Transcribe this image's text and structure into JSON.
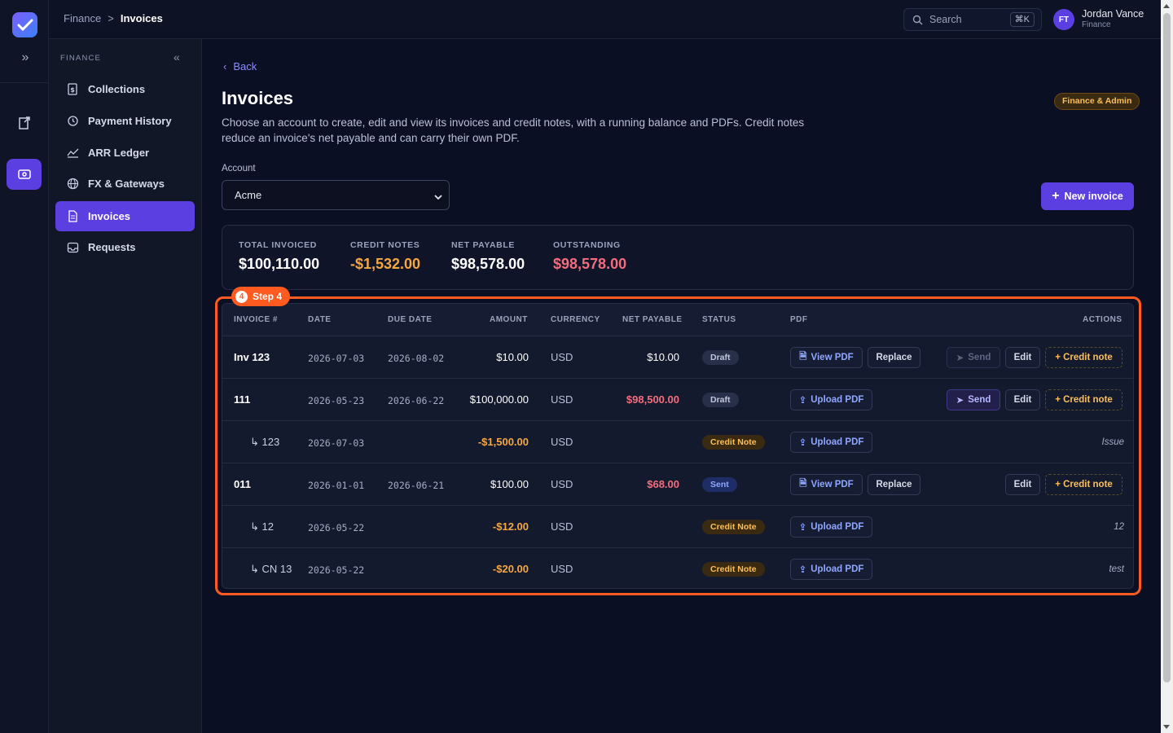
{
  "breadcrumb": {
    "parent": "Finance",
    "separator": ">",
    "current": "Invoices"
  },
  "search": {
    "placeholder": "Search",
    "shortcut": "⌘K"
  },
  "user": {
    "initials": "FT",
    "name": "Jordan Vance",
    "role": "Finance"
  },
  "sidebar": {
    "section": "FINANCE",
    "items": [
      {
        "label": "Collections",
        "icon": "dollar-doc-icon"
      },
      {
        "label": "Payment History",
        "icon": "history-icon"
      },
      {
        "label": "ARR Ledger",
        "icon": "trend-icon"
      },
      {
        "label": "FX & Gateways",
        "icon": "globe-icon"
      },
      {
        "label": "Invoices",
        "icon": "document-icon",
        "active": true
      },
      {
        "label": "Requests",
        "icon": "inbox-icon"
      }
    ]
  },
  "page": {
    "back": "Back",
    "title": "Invoices",
    "description": "Choose an account to create, edit and view its invoices and credit notes, with a running balance and PDFs. Credit notes reduce an invoice's net payable and can carry their own PDF.",
    "badge": "Finance & Admin",
    "account_label": "Account",
    "account_value": "Acme",
    "new_button": "New invoice"
  },
  "summary": {
    "total_label": "TOTAL INVOICED",
    "total": "$100,110.00",
    "credit_label": "CREDIT NOTES",
    "credit": "-$1,532.00",
    "net_label": "NET PAYABLE",
    "net": "$98,578.00",
    "outstanding_label": "OUTSTANDING",
    "outstanding": "$98,578.00"
  },
  "step": {
    "number": "4",
    "label": "Step 4"
  },
  "table": {
    "headers": {
      "invoice": "INVOICE #",
      "date": "DATE",
      "due": "DUE DATE",
      "amount": "AMOUNT",
      "currency": "CURRENCY",
      "net": "NET PAYABLE",
      "status": "STATUS",
      "pdf": "PDF",
      "actions": "ACTIONS"
    },
    "buttons": {
      "view_pdf": "View PDF",
      "upload_pdf": "Upload PDF",
      "replace": "Replace",
      "send": "Send",
      "edit": "Edit",
      "credit": "+ Credit note"
    },
    "rows": [
      {
        "invoice": "Inv 123",
        "date": "2026-07-03",
        "due": "2026-08-02",
        "amount": "$10.00",
        "currency": "USD",
        "net": "$10.00",
        "status": "Draft"
      },
      {
        "invoice": "111",
        "date": "2026-05-23",
        "due": "2026-06-22",
        "amount": "$100,000.00",
        "currency": "USD",
        "net": "$98,500.00",
        "status": "Draft"
      },
      {
        "invoice": "↳ 123",
        "date": "2026-07-03",
        "due": "",
        "amount": "-$1,500.00",
        "currency": "USD",
        "net": "",
        "status": "Credit Note",
        "note": "Issue"
      },
      {
        "invoice": "011",
        "date": "2026-01-01",
        "due": "2026-06-21",
        "amount": "$100.00",
        "currency": "USD",
        "net": "$68.00",
        "status": "Sent"
      },
      {
        "invoice": "↳ 12",
        "date": "2026-05-22",
        "due": "",
        "amount": "-$12.00",
        "currency": "USD",
        "net": "",
        "status": "Credit Note",
        "note": "12"
      },
      {
        "invoice": "↳ CN 13",
        "date": "2026-05-22",
        "due": "",
        "amount": "-$20.00",
        "currency": "USD",
        "net": "",
        "status": "Credit Note",
        "note": "test"
      }
    ]
  },
  "colors": {
    "accent": "#5b3fe0",
    "step": "#ff5a1f",
    "warning": "#f5a742",
    "danger": "#f26d7d"
  }
}
